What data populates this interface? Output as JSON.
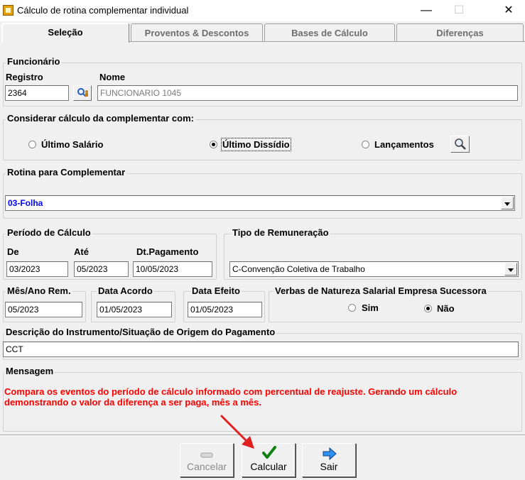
{
  "window": {
    "title": "Cálculo de rotina complementar individual",
    "minimize": "—",
    "maximize": "☐",
    "close": "✕"
  },
  "tabs": [
    {
      "label": "Seleção",
      "active": true
    },
    {
      "label": "Proventos & Descontos",
      "active": false
    },
    {
      "label": "Bases de Cálculo",
      "active": false
    },
    {
      "label": "Diferenças",
      "active": false
    }
  ],
  "funcionario": {
    "group_title": "Funcionário",
    "registro_label": "Registro",
    "registro_value": "2364",
    "nome_label": "Nome",
    "nome_value": "FUNCIONARIO 1045"
  },
  "considerar": {
    "group_title": "Considerar cálculo da complementar com:",
    "options": [
      {
        "label": "Último Salário",
        "checked": false
      },
      {
        "label": "Último Dissídio",
        "checked": true
      },
      {
        "label": "Lançamentos",
        "checked": false
      }
    ]
  },
  "rotina": {
    "group_title": "Rotina para Complementar",
    "value": "03-Folha"
  },
  "periodo": {
    "group_title": "Período de Cálculo",
    "de_label": "De",
    "de_value": "03/2023",
    "ate_label": "Até",
    "ate_value": "05/2023",
    "pag_label": "Dt.Pagamento",
    "pag_value": "10/05/2023"
  },
  "tipo_remuneracao": {
    "group_title": "Tipo de Remuneração",
    "value": "C-Convenção Coletiva de Trabalho"
  },
  "mes_ano_rem": {
    "label": "Mês/Ano Rem.",
    "value": "05/2023"
  },
  "data_acordo": {
    "label": "Data Acordo",
    "value": "01/05/2023"
  },
  "data_efeito": {
    "label": "Data Efeito",
    "value": "01/05/2023"
  },
  "verbas": {
    "group_title": "Verbas de Natureza Salarial Empresa Sucessora",
    "sim_label": "Sim",
    "nao_label": "Não",
    "selected": "Não"
  },
  "descricao": {
    "group_title": "Descrição do Instrumento/Situação de Origem do Pagamento",
    "value": "CCT"
  },
  "mensagem": {
    "group_title": "Mensagem",
    "line1": "Compara os eventos do período de cálculo informado com percentual de reajuste. Gerando um cálculo",
    "line2": "demonstrando o valor da diferença a ser paga, mês a mês."
  },
  "buttons": {
    "cancelar": "Cancelar",
    "calcular": "Calcular",
    "sair": "Sair"
  },
  "colors": {
    "message_red": "#ff0000",
    "routine_blue": "#0000ff",
    "annotation_arrow": "#e02020"
  }
}
